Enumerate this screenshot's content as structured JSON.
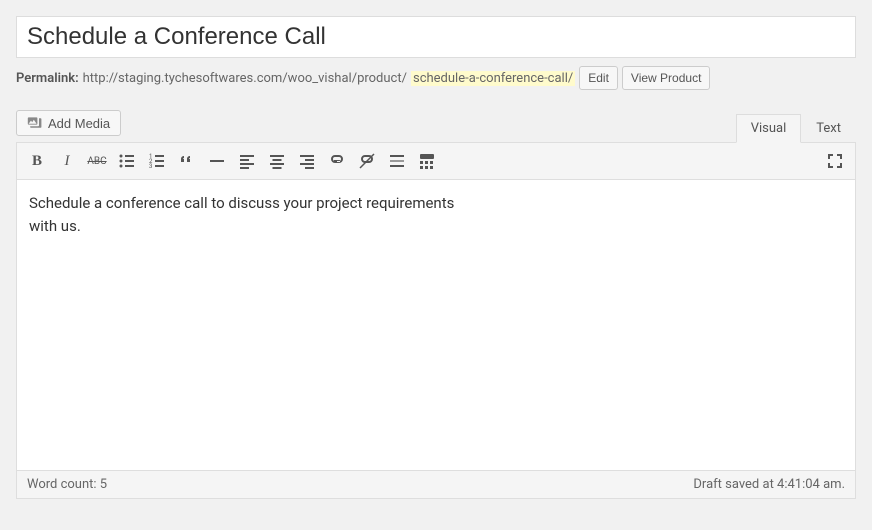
{
  "title": "Schedule a Conference Call",
  "permalink": {
    "label": "Permalink:",
    "base": "http://staging.tychesoftwares.com/woo_vishal/product/",
    "slug": "schedule-a-conference-call/",
    "edit_label": "Edit",
    "view_label": "View Product"
  },
  "media_button": "Add Media",
  "tabs": {
    "visual": "Visual",
    "text": "Text"
  },
  "content_line1": "Schedule a conference call to discuss your project requirements",
  "content_line2": "with us.",
  "status": {
    "wordcount_label": "Word count: ",
    "wordcount": "5",
    "draft_saved": "Draft saved at 4:41:04 am."
  }
}
